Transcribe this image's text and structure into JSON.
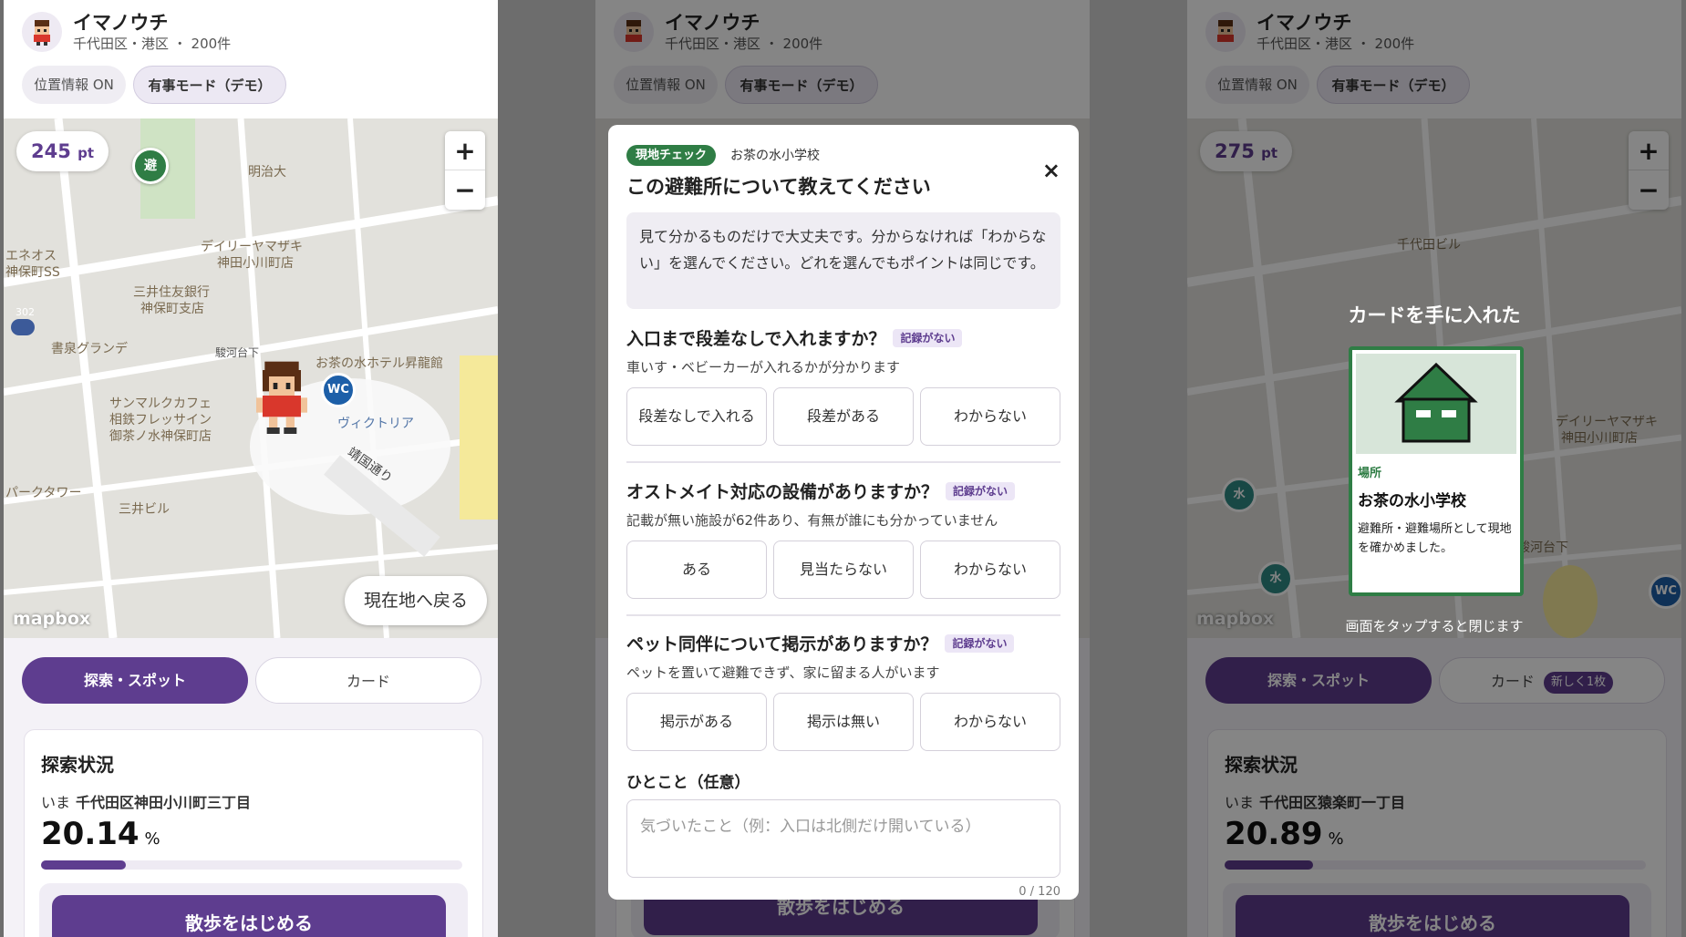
{
  "header": {
    "app_title": "イマノウチ",
    "subtitle": "千代田区・港区 ・ 200件",
    "location_chip": "位置情報 ON",
    "mode_chip": "有事モード（デモ）"
  },
  "panel1": {
    "points": "245",
    "points_unit": "pt",
    "zoom_in": "+",
    "zoom_out": "−",
    "shelter_marker": "避",
    "wc_marker": "WC",
    "map_labels": [
      "明治大",
      "エネオス",
      "神保町SS",
      "デイリーヤマザキ",
      "神田小川町店",
      "三井住友銀行",
      "神保町支店",
      "302",
      "書泉グランデ",
      "駿河台下",
      "お茶の水ホテル昇龍館",
      "サンマルクカフェ",
      "相鉄フレッサイン",
      "御茶ノ水神保町店",
      "ヴィクトリア",
      "靖国通り",
      "パークタワー",
      "三井ビル"
    ],
    "mapbox": "mapbox",
    "return_button": "現在地へ戻る",
    "tab_explore": "探索・スポット",
    "tab_card": "カード",
    "status_title": "探索状況",
    "now_label": "いま",
    "now_place": "千代田区神田小川町三丁目",
    "percent": "20.14",
    "percent_unit": "%",
    "progress": 0.2014,
    "walk_button": "散歩をはじめる"
  },
  "panel2": {
    "badge": "現地チェック",
    "school": "お茶の水小学校",
    "title": "この避難所について教えてください",
    "close": "×",
    "note": "見て分かるものだけで大丈夫です。分からなければ「わからない」を選んでください。どれを選んでもポイントは同じです。",
    "questions": [
      {
        "title": "入口まで段差なしで入れますか？",
        "badge": "記録がない",
        "desc": "車いす・ベビーカーが入れるかが分かります",
        "options": [
          "段差なしで入れる",
          "段差がある",
          "わからない"
        ]
      },
      {
        "title": "オストメイト対応の設備がありますか？",
        "badge": "記録がない",
        "desc": "記載が無い施設が62件あり、有無が誰にも分かっていません",
        "options": [
          "ある",
          "見当たらない",
          "わからない"
        ]
      },
      {
        "title": "ペット同伴について掲示がありますか？",
        "badge": "記録がない",
        "desc": "ペットを置いて避難できず、家に留まる人がいます",
        "options": [
          "掲示がある",
          "掲示は無い",
          "わからない"
        ]
      }
    ],
    "comment_label": "ひとこと（任意）",
    "comment_placeholder": "気づいたこと（例：入口は北側だけ開いている）",
    "counter": "0 / 120"
  },
  "panel3": {
    "points": "275",
    "points_unit": "pt",
    "reveal_title": "カードを手に入れた",
    "card_kind": "場所",
    "card_name": "お茶の水小学校",
    "card_desc": "避難所・避難場所として現地を確かめました。",
    "tap_close": "画面をタップすると閉じます",
    "mapbox": "mapbox",
    "map_labels": [
      "デイリーヤマザキ",
      "神田小川町店",
      "駿河台下",
      "千代田ビル"
    ],
    "water_marker": "水",
    "wc_marker": "WC",
    "tab_explore": "探索・スポット",
    "tab_card": "カード",
    "new_badge": "新しく1枚",
    "status_title": "探索状況",
    "now_label": "いま",
    "now_place": "千代田区猿楽町一丁目",
    "percent": "20.89",
    "percent_unit": "%",
    "progress": 0.2089,
    "walk_button": "散歩をはじめる"
  },
  "colors": {
    "brand_purple": "#5e3d8f",
    "shelter_green": "#2f7d45",
    "wc_blue": "#1d5fa8"
  }
}
